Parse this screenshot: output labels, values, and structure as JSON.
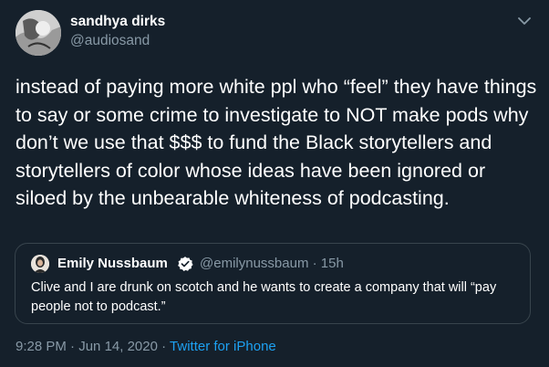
{
  "author": {
    "display_name": "sandhya dirks",
    "handle": "@audiosand"
  },
  "tweet": {
    "text": "instead of paying more white ppl who “feel” they have things to say or some crime to investigate to NOT make pods why don’t we use that $$$ to fund the Black storytellers and storytellers of color whose ideas have been ignored or siloed by the unbearable whiteness of podcasting."
  },
  "quote": {
    "display_name": "Emily Nussbaum",
    "handle": "@emilynussbaum",
    "separator": "·",
    "time": "15h",
    "text": "Clive and I are drunk on scotch and he wants to create a company that will “pay people not to podcast.”"
  },
  "meta": {
    "time": "9:28 PM",
    "separator": "·",
    "date": "Jun 14, 2020",
    "source": "Twitter for iPhone"
  },
  "icons": {
    "more": "chevron-down-icon",
    "verified": "verified-badge-icon"
  },
  "colors": {
    "background": "#15202b",
    "secondary_text": "#8899a6",
    "link": "#1da1f2",
    "verified": "#ffffff"
  }
}
